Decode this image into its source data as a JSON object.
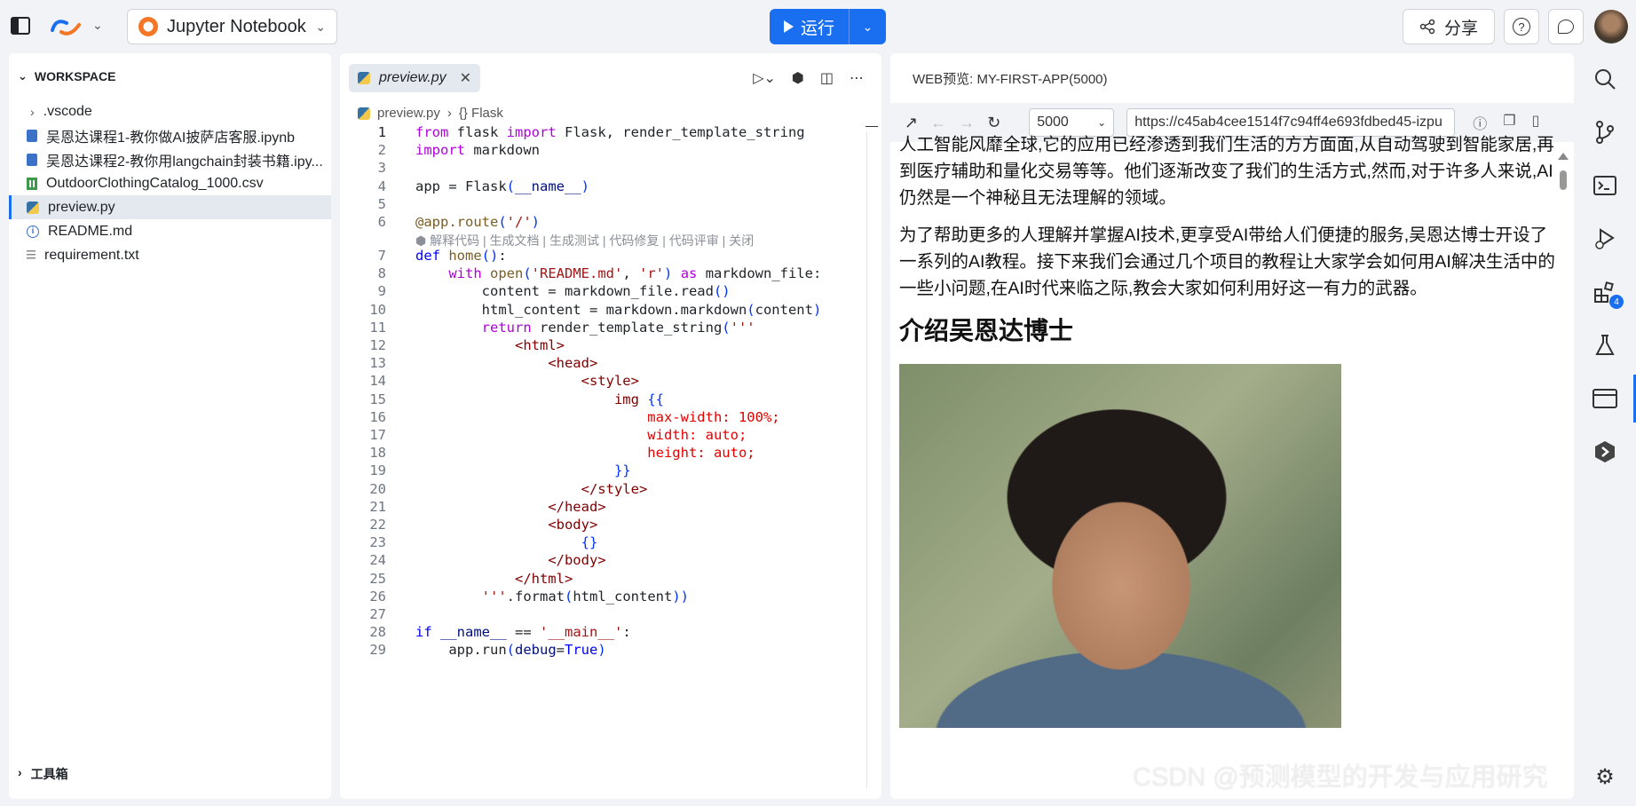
{
  "topbar": {
    "kernel_label": "Jupyter Notebook",
    "run_label": "运行",
    "share_label": "分享"
  },
  "explorer": {
    "workspace_label": "WORKSPACE",
    "items": [
      {
        "label": ".vscode",
        "icon": "chevron-right-icon"
      },
      {
        "label": "吴恩达课程1-教你做AI披萨店客服.ipynb",
        "icon": "notebook-icon"
      },
      {
        "label": "吴恩达课程2-教你用langchain封装书籍.ipy...",
        "icon": "notebook-icon"
      },
      {
        "label": "OutdoorClothingCatalog_1000.csv",
        "icon": "csv-icon"
      },
      {
        "label": "preview.py",
        "icon": "python-icon",
        "selected": true
      },
      {
        "label": "README.md",
        "icon": "info-icon"
      },
      {
        "label": "requirement.txt",
        "icon": "text-file-icon"
      }
    ],
    "toolbox_label": "工具箱"
  },
  "editor": {
    "tab_label": "preview.py",
    "breadcrumb_file": "preview.py",
    "breadcrumb_symbol": "{} Flask",
    "codelens": "解释代码 | 生成文档 | 生成测试 | 代码修复 | 代码评审 | 关闭",
    "line_numbers": [
      "1",
      "2",
      "3",
      "4",
      "5",
      "6",
      "7",
      "8",
      "9",
      "10",
      "11",
      "12",
      "13",
      "14",
      "15",
      "16",
      "17",
      "18",
      "19",
      "20",
      "21",
      "22",
      "23",
      "24",
      "25",
      "26",
      "27",
      "28",
      "29"
    ]
  },
  "preview": {
    "title": "WEB预览: MY-FIRST-APP(5000)",
    "port": "5000",
    "url": "https://c45ab4cee1514f7c94ff4e693fdbed45-izpu",
    "para1": "人工智能风靡全球,它的应用已经渗透到我们生活的方方面面,从自动驾驶到智能家居,再到医疗辅助和量化交易等等。他们逐渐改变了我们的生活方式,然而,对于许多人来说,AI仍然是一个神秘且无法理解的领域。",
    "para2": "为了帮助更多的人理解并掌握AI技术,更享受AI带给人们便捷的服务,吴恩达博士开设了一系列的AI教程。接下来我们会通过几个项目的教程让大家学会如何用AI解决生活中的一些小问题,在AI时代来临之际,教会大家如何利用好这一有力的武器。",
    "heading": "介绍吴恩达博士"
  },
  "activity": {
    "extensions_badge": "4"
  },
  "watermark": "CSDN @预测模型的开发与应用研究"
}
